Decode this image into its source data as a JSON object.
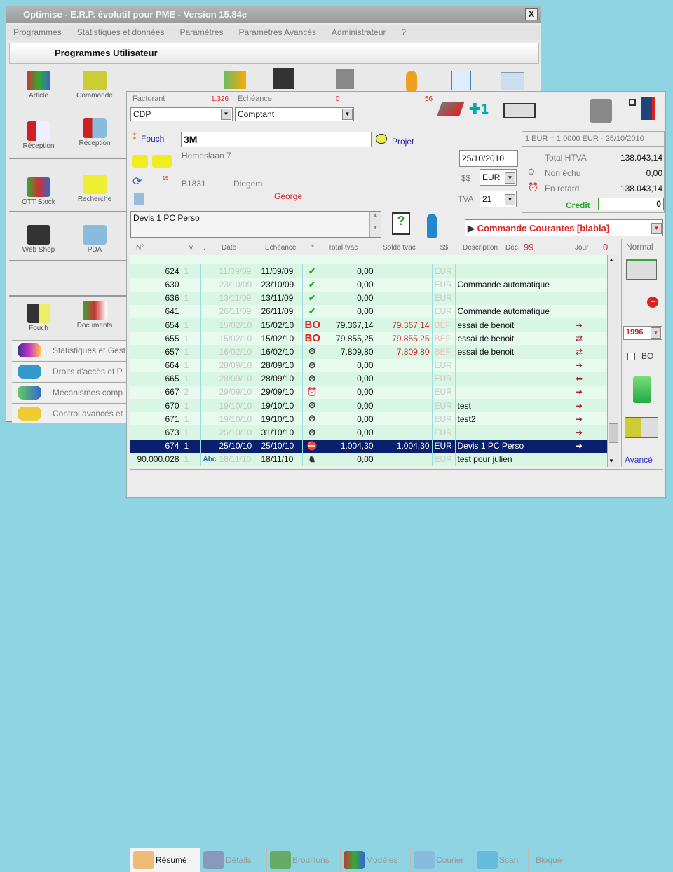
{
  "back": {
    "title": "Optimise - E.R.P. évolutif pour PME - Version 15.84e",
    "close": "X",
    "menu": [
      "Programmes",
      "Statistiques et données",
      "Paramètres",
      "Paramètres Avancés",
      "Administrateur",
      "?"
    ],
    "header": "Programmes Utilisateur",
    "tools": [
      {
        "label": "Article"
      },
      {
        "label": "Commande"
      },
      {
        "label": "Réception"
      },
      {
        "label": "Réception"
      },
      {
        "label": "QTT Stock"
      },
      {
        "label": "Recherche"
      },
      {
        "label": "Web Shop"
      },
      {
        "label": "PDA"
      },
      {
        "label": "Fouch"
      },
      {
        "label": "Documents"
      }
    ],
    "list": [
      "Statistiques et Gest",
      "Droits d'accès et P",
      "Mécanismes comp",
      "Control avancés et"
    ]
  },
  "front": {
    "facturant_label": "Facturant",
    "facturant_count": "1.326",
    "facturant": "CDP",
    "echeance_label": "Echéance",
    "echeance_count": "0",
    "echeance_count2": "56",
    "echeance": "Comptant",
    "client_link": "Fouch",
    "client": "3M",
    "projet": "Projet",
    "address": "Hemeslaan 7",
    "postal": "B1831",
    "city": "Diegem",
    "contact": "George",
    "date": "25/10/2010",
    "currency_label": "$$",
    "currency": "EUR",
    "tva_label": "TVA",
    "tva": "21",
    "rate": "1 EUR = 1,0000 EUR - 25/10/2010",
    "total_htva_label": "Total HTVA",
    "total_htva": "138.043,14",
    "non_echu_label": "Non échu",
    "non_echu": "0,00",
    "en_retard_label": "En retard",
    "en_retard": "138.043,14",
    "credit_label": "Credit",
    "credit": "0",
    "note": "Devis 1 PC Perso",
    "doc_type": "Commande Courantes [blabla]",
    "columns": [
      "N°",
      "v.",
      ".",
      "Date",
      "Echéance",
      "*",
      "Total tvac",
      "Solde tvac",
      "$$",
      "Description",
      "Jour"
    ],
    "desc_count_label": "Dec.",
    "desc_count": "99",
    "jour_count": "0",
    "rows": [
      {
        "n": "624",
        "v": "1",
        "f": "",
        "d": "11/09/09",
        "e": "11/09/09",
        "s": "check",
        "t": "0,00",
        "so": "",
        "c": "EUR",
        "de": "",
        "j": ""
      },
      {
        "n": "630",
        "v": "",
        "f": "",
        "d": "23/10/09",
        "e": "23/10/09",
        "s": "check",
        "t": "0,00",
        "so": "",
        "c": "EUR",
        "de": "Commande automatique",
        "j": ""
      },
      {
        "n": "636",
        "v": "1",
        "f": "",
        "d": "13/11/09",
        "e": "13/11/09",
        "s": "check",
        "t": "0,00",
        "so": "",
        "c": "EUR",
        "de": "",
        "j": ""
      },
      {
        "n": "641",
        "v": "",
        "f": "",
        "d": "26/11/09",
        "e": "26/11/09",
        "s": "check",
        "t": "0,00",
        "so": "",
        "c": "EUR",
        "de": "Commande automatique",
        "j": ""
      },
      {
        "n": "654",
        "v": "1",
        "f": "",
        "d": "15/02/10",
        "e": "15/02/10",
        "s": "BO",
        "t": "79.367,14",
        "so": "79.367,14",
        "c": "BEF",
        "de": "essai de benoit",
        "j": "out"
      },
      {
        "n": "655",
        "v": "1",
        "f": "",
        "d": "15/02/10",
        "e": "15/02/10",
        "s": "BO",
        "t": "79.855,25",
        "so": "79.855,25",
        "c": "BEF",
        "de": "essai de benoit",
        "j": "both"
      },
      {
        "n": "657",
        "v": "1",
        "f": "",
        "d": "16/02/10",
        "e": "16/02/10",
        "s": "clock",
        "t": "7.809,80",
        "so": "7.809,80",
        "c": "BEF",
        "de": "essai de benoit",
        "j": "both"
      },
      {
        "n": "664",
        "v": "1",
        "f": "",
        "d": "28/09/10",
        "e": "28/09/10",
        "s": "clock",
        "t": "0,00",
        "so": "",
        "c": "EUR",
        "de": "",
        "j": "out"
      },
      {
        "n": "665",
        "v": "1",
        "f": "",
        "d": "28/09/10",
        "e": "28/09/10",
        "s": "clock",
        "t": "0,00",
        "so": "",
        "c": "EUR",
        "de": "",
        "j": "in"
      },
      {
        "n": "667",
        "v": "2",
        "f": "",
        "d": "29/09/10",
        "e": "29/09/10",
        "s": "late",
        "t": "0,00",
        "so": "",
        "c": "EUR",
        "de": "",
        "j": "out"
      },
      {
        "n": "670",
        "v": "1",
        "f": "",
        "d": "19/10/10",
        "e": "19/10/10",
        "s": "clock",
        "t": "0,00",
        "so": "",
        "c": "EUR",
        "de": "test",
        "j": "out"
      },
      {
        "n": "671",
        "v": "1",
        "f": "",
        "d": "19/10/10",
        "e": "19/10/10",
        "s": "clock",
        "t": "0,00",
        "so": "",
        "c": "EUR",
        "de": "test2",
        "j": "out"
      },
      {
        "n": "673",
        "v": "1",
        "f": "",
        "d": "25/10/10",
        "e": "31/10/10",
        "s": "clock",
        "t": "0,00",
        "so": "",
        "c": "EUR",
        "de": "",
        "j": "out"
      },
      {
        "n": "674",
        "v": "1",
        "f": "",
        "d": "25/10/10",
        "e": "25/10/10",
        "s": "stop",
        "t": "1.004,30",
        "so": "1.004,30",
        "c": "EUR",
        "de": "Devis 1 PC Perso",
        "j": "out",
        "sel": true
      },
      {
        "n": "90.000.028",
        "v": "1",
        "f": "Abc",
        "d": "18/11/10",
        "e": "18/11/10",
        "s": "person",
        "t": "0,00",
        "so": "",
        "c": "EUR",
        "de": "test pour julien",
        "j": ""
      }
    ],
    "side": {
      "mode": "Normal",
      "year": "1996",
      "bo_label": "BO",
      "advanced": "Avancé"
    },
    "tabs": [
      "Résumé",
      "Détails",
      "Brouillons",
      "Modèles",
      "Courier",
      "Scan",
      "Bloqué"
    ]
  }
}
